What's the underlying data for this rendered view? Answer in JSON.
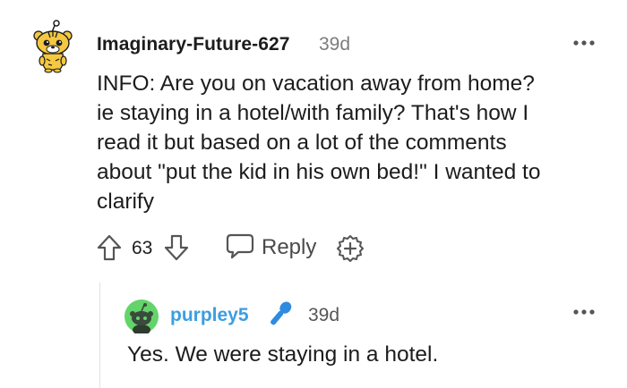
{
  "comment": {
    "username": "Imaginary-Future-627",
    "age": "39d",
    "avatar_icon": "snoo-tiger-avatar-icon",
    "body_lines": [
      "INFO: Are you on vacation away from home?",
      "ie staying in a hotel/with family? That's how I",
      "read it but based on a lot of the comments",
      "about \"put the kid in his own bed!\" I wanted to",
      "clarify"
    ],
    "score": "63",
    "reply_label": "Reply",
    "more_icon": "more-options-icon",
    "upvote_icon": "upvote-arrow-icon",
    "downvote_icon": "downvote-arrow-icon",
    "reply_icon": "speech-bubble-icon",
    "award_icon": "award-plus-icon"
  },
  "reply": {
    "username": "purpley5",
    "age": "39d",
    "avatar_icon": "green-snoo-avatar-icon",
    "flair_icon": "microphone-icon",
    "body": "Yes. We were staying in a hotel.",
    "more_icon": "more-options-icon"
  },
  "colors": {
    "username_reply": "#3b9ee2",
    "meta_gray": "#7c7c7c",
    "text": "#1c1c1c",
    "thread_line": "#e2e2e2"
  }
}
